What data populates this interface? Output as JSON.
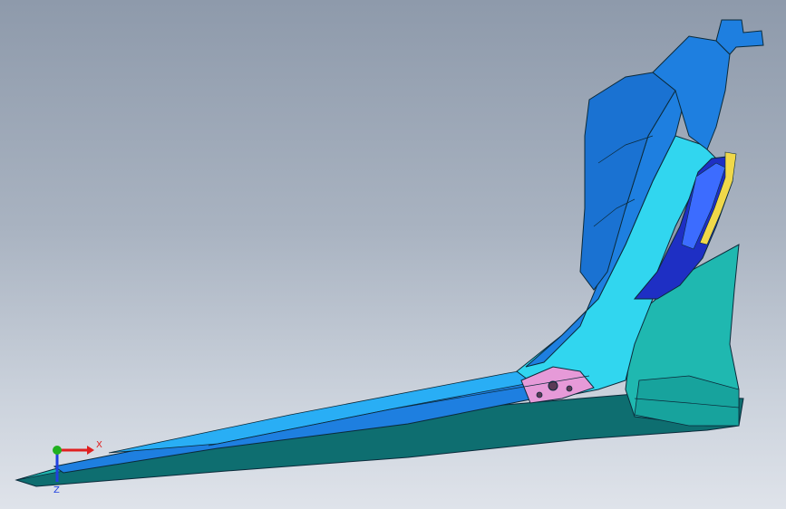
{
  "viewport": {
    "background_top": "#8e9aab",
    "background_bottom": "#dfe3ea"
  },
  "model": {
    "colors": {
      "base_teal": "#1fb8b0",
      "dark_teal": "#0e6e70",
      "deck_blue": "#1e7fe0",
      "light_blue": "#29aef5",
      "cyan": "#31d6ef",
      "handle_blue": "#1e2fc4",
      "handle_light": "#3c6cff",
      "accent_yellow": "#f0d84a",
      "pink_patch": "#e69ad8",
      "edge": "#0b2a3a"
    }
  },
  "triad": {
    "x_label": "X",
    "z_label": "Z",
    "x_color": "#e02020",
    "y_color": "#20b020",
    "z_color": "#2040e0"
  }
}
